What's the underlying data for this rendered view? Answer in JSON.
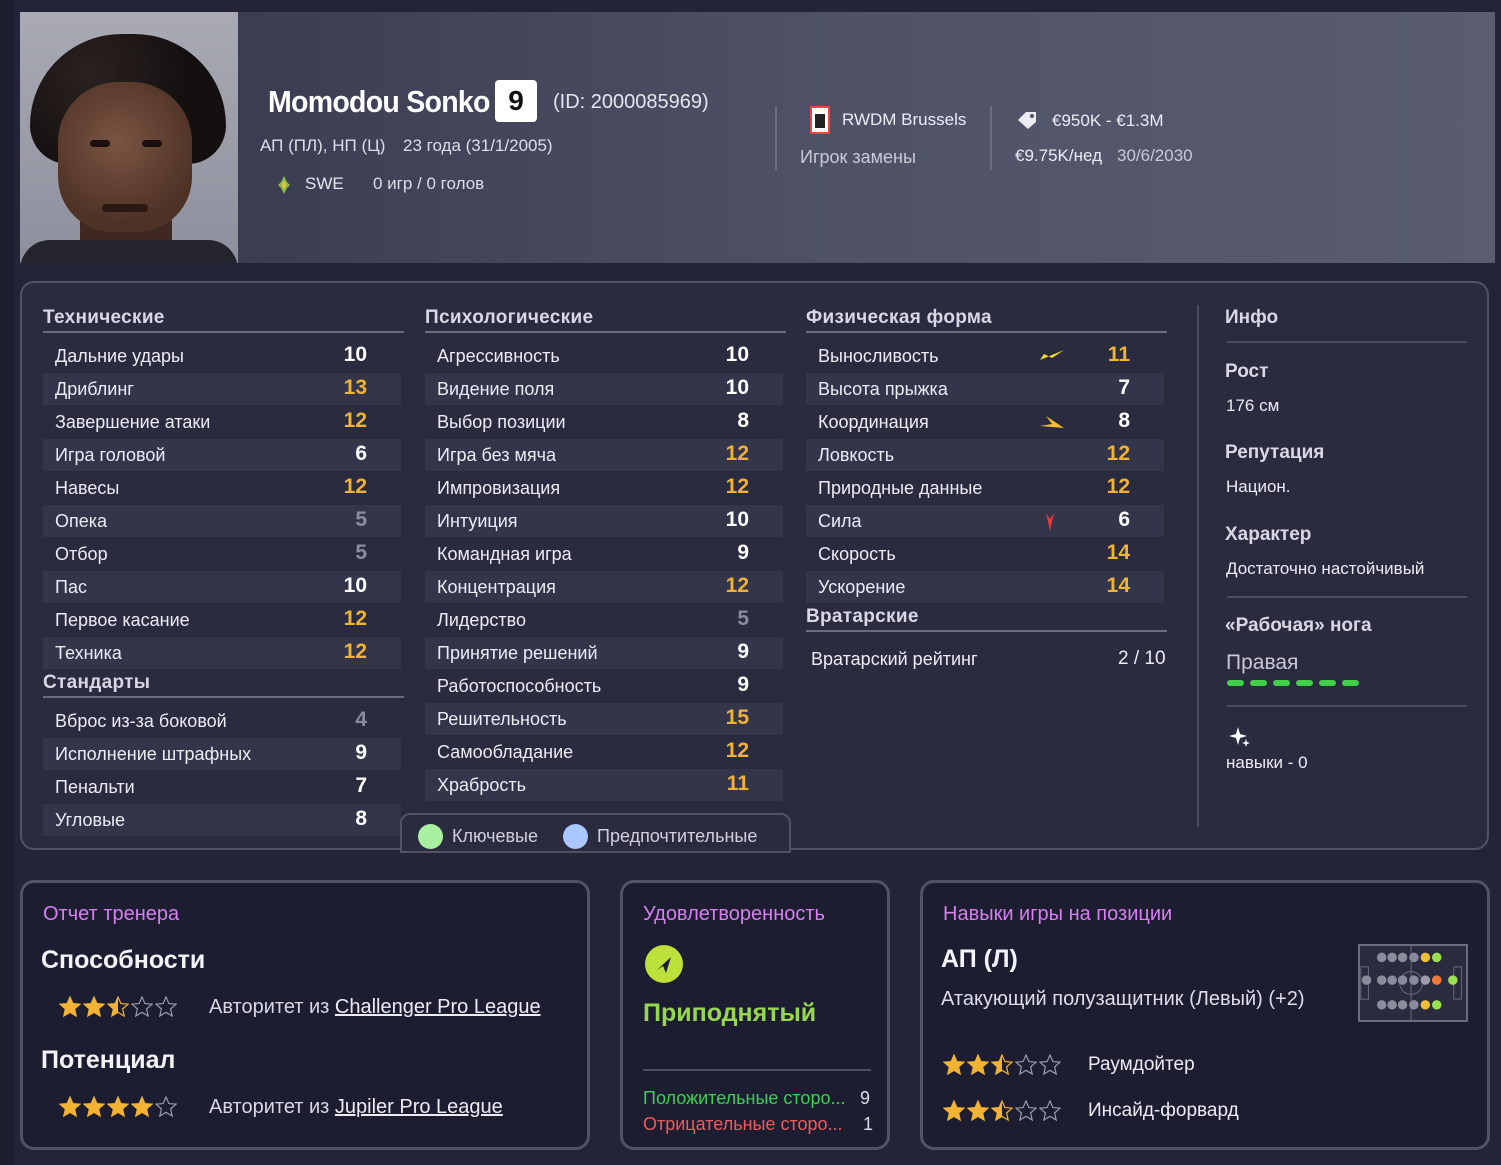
{
  "player": {
    "name": "Momodou Sonko",
    "number": "9",
    "id_text": "(ID: 2000085969)",
    "positions": "АП (ПЛ), НП (Ц)",
    "age": "23 года (31/1/2005)",
    "nationality": "SWE",
    "apps": "0 игр / 0 голов",
    "club": "RWDM Brussels",
    "squad_role": "Игрок замены",
    "value": "€950K - €1.3M",
    "wage": "€9.75K/нед",
    "contract_end": "30/6/2030"
  },
  "technical": {
    "title": "Технические",
    "items": [
      {
        "label": "Дальние удары",
        "value": "10",
        "tone": "white"
      },
      {
        "label": "Дриблинг",
        "value": "13",
        "tone": "gold"
      },
      {
        "label": "Завершение атаки",
        "value": "12",
        "tone": "gold"
      },
      {
        "label": "Игра головой",
        "value": "6",
        "tone": "white"
      },
      {
        "label": "Навесы",
        "value": "12",
        "tone": "gold"
      },
      {
        "label": "Опека",
        "value": "5",
        "tone": "grey"
      },
      {
        "label": "Отбор",
        "value": "5",
        "tone": "grey"
      },
      {
        "label": "Пас",
        "value": "10",
        "tone": "white"
      },
      {
        "label": "Первое касание",
        "value": "12",
        "tone": "gold"
      },
      {
        "label": "Техника",
        "value": "12",
        "tone": "gold"
      }
    ]
  },
  "set_pieces": {
    "title": "Стандарты",
    "items": [
      {
        "label": "Вброс из-за боковой",
        "value": "4",
        "tone": "grey"
      },
      {
        "label": "Исполнение штрафных",
        "value": "9",
        "tone": "white"
      },
      {
        "label": "Пенальти",
        "value": "7",
        "tone": "white"
      },
      {
        "label": "Угловые",
        "value": "8",
        "tone": "white"
      }
    ]
  },
  "mental": {
    "title": "Психологические",
    "items": [
      {
        "label": "Агрессивность",
        "value": "10",
        "tone": "white"
      },
      {
        "label": "Видение поля",
        "value": "10",
        "tone": "white"
      },
      {
        "label": "Выбор позиции",
        "value": "8",
        "tone": "white"
      },
      {
        "label": "Игра без мяча",
        "value": "12",
        "tone": "gold"
      },
      {
        "label": "Импровизация",
        "value": "12",
        "tone": "gold"
      },
      {
        "label": "Интуиция",
        "value": "10",
        "tone": "white"
      },
      {
        "label": "Командная игра",
        "value": "9",
        "tone": "white"
      },
      {
        "label": "Концентрация",
        "value": "12",
        "tone": "gold"
      },
      {
        "label": "Лидерство",
        "value": "5",
        "tone": "grey"
      },
      {
        "label": "Принятие решений",
        "value": "9",
        "tone": "white"
      },
      {
        "label": "Работоспособность",
        "value": "9",
        "tone": "white"
      },
      {
        "label": "Решительность",
        "value": "15",
        "tone": "gold"
      },
      {
        "label": "Самообладание",
        "value": "12",
        "tone": "gold"
      },
      {
        "label": "Храбрость",
        "value": "11",
        "tone": "gold"
      }
    ]
  },
  "physical": {
    "title": "Физическая форма",
    "items": [
      {
        "label": "Выносливость",
        "value": "11",
        "tone": "gold",
        "trend": "up"
      },
      {
        "label": "Высота прыжка",
        "value": "7",
        "tone": "white",
        "trend": ""
      },
      {
        "label": "Координация",
        "value": "8",
        "tone": "white",
        "trend": "side"
      },
      {
        "label": "Ловкость",
        "value": "12",
        "tone": "gold",
        "trend": ""
      },
      {
        "label": "Природные данные",
        "value": "12",
        "tone": "gold",
        "trend": ""
      },
      {
        "label": "Сила",
        "value": "6",
        "tone": "white",
        "trend": "down"
      },
      {
        "label": "Скорость",
        "value": "14",
        "tone": "gold",
        "trend": ""
      },
      {
        "label": "Ускорение",
        "value": "14",
        "tone": "gold",
        "trend": ""
      }
    ]
  },
  "goalkeeping": {
    "title": "Вратарские",
    "label": "Вратарский рейтинг",
    "value": "2 / 10"
  },
  "legend": {
    "key": "Ключевые",
    "preferred": "Предпочтительные",
    "key_color": "#a8f0a0",
    "preferred_color": "#a9c8ff"
  },
  "info": {
    "title": "Инфо",
    "height_label": "Рост",
    "height_value": "176 см",
    "reputation_label": "Репутация",
    "reputation_value": "Национ.",
    "personality_label": "Характер",
    "personality_value": "Достаточно настойчивый",
    "foot_label": "«Рабочая» нога",
    "foot_value": "Правая",
    "foot_level": 1.0,
    "skills_text": "навыки - 0"
  },
  "coach_report": {
    "title": "Отчет тренера",
    "ability_label": "Способности",
    "ability_stars": 2.5,
    "ability_prefix": "Авторитет из ",
    "ability_league": "Challenger Pro League",
    "potential_label": "Потенциал",
    "potential_stars": 4,
    "potential_prefix": "Авторитет из ",
    "potential_league": "Jupiler Pro League"
  },
  "happiness": {
    "title": "Удовлетворенность",
    "mood": "Приподнятый",
    "positives_label": "Положительные сторо...",
    "positives_count": "9",
    "negatives_label": "Отрицательные сторо...",
    "negatives_count": "1"
  },
  "position_skills": {
    "title": "Навыки игры на позиции",
    "position": "АП (Л)",
    "position_full": "Атакующий полузащитник (Левый) (+2)",
    "roles": [
      {
        "name": "Раумдойтер",
        "stars": 2.5
      },
      {
        "name": "Инсайд-форвард",
        "stars": 2.5
      }
    ]
  },
  "colors": {
    "gold": "#f2b234",
    "accent_title": "#d77ff0",
    "mood_green": "#97d651",
    "positive": "#3dcf55",
    "negative": "#f25a5a"
  }
}
